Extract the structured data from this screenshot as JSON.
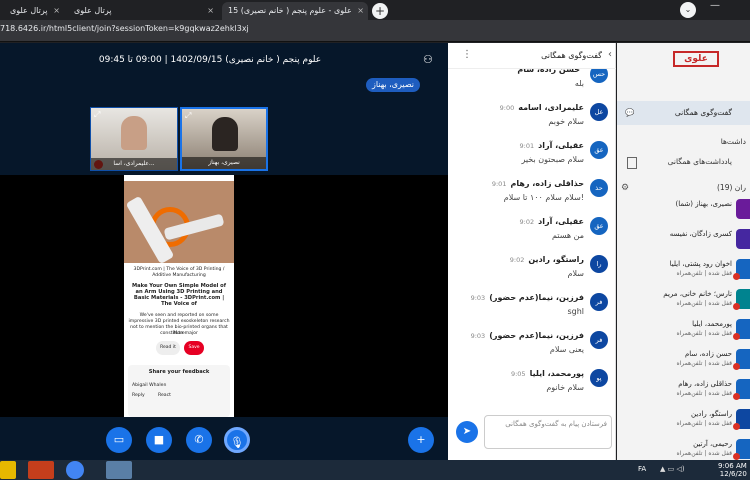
{
  "browser": {
    "tabs": [
      {
        "label": "پرتال علوی",
        "close": "×"
      },
      {
        "label": "پرتال علوی",
        "close": "×"
      },
      {
        "label": "علوی - علوم پنجم ( خانم نصیری) 15",
        "close": "×"
      }
    ],
    "new_tab": "+",
    "menu": "⌄",
    "url": "718.6426.ir/html5client/join?sessionToken=k9gqkwaz2ehkl3xj"
  },
  "session": {
    "title": "علوم پنجم ( خانم نصیری) 1402/09/15 | 09:00 تا 09:45",
    "presenter": "نصیری، بهناز",
    "cams": [
      {
        "name": "علیمرادی، اسا..."
      },
      {
        "name": "نصیری، بهناز"
      }
    ]
  },
  "shared_screen": {
    "source": "3DPrint.com | The Voice of 3D Printing / Additive Manufacturing",
    "headline": "Make Your Own Simple Model of an Arm Using 3D Printing and Basic Materials - 3DPrint.com | The Voice of",
    "body": "We've seen and reported on some impressive 3D printed exoskeleton research not to mention the bio-printed organs that constitute major",
    "more": "More",
    "read_btn": "Read it",
    "save_btn": "Save",
    "feedback_title": "Share your feedback",
    "feedback_user": "Abigail Whalen",
    "feedback_reply": "Reply",
    "feedback_react": "React"
  },
  "controls": {
    "screen": "▭",
    "video": "■",
    "phone": "✆",
    "mic": "🎙",
    "plus": "+"
  },
  "chat": {
    "title": "گفت‌وگوی همگانی",
    "back": "‹",
    "dots": "⋮",
    "messages": [
      {
        "initials": "حس",
        "name": "حسن زاده، سام",
        "time": "",
        "text": "بله",
        "color": "#1565c0"
      },
      {
        "initials": "عل",
        "name": "علیمرادی، اسامه",
        "time": "9:00",
        "text": "سلام خوبم",
        "color": "#0d47a1"
      },
      {
        "initials": "عق",
        "name": "عقیلی، آراد",
        "time": "9:01",
        "text": "سلام صبحتون بخیر",
        "color": "#1565c0"
      },
      {
        "initials": "حذ",
        "name": "حذاقلی زاده، رهام",
        "time": "9:01",
        "text": "سلام سلام ۱۰۰ تا سلام!",
        "color": "#1565c0"
      },
      {
        "initials": "عق",
        "name": "عقیلی، آراد",
        "time": "9:02",
        "text": "من هستم",
        "color": "#1565c0"
      },
      {
        "initials": "را",
        "name": "راستگو، رادین",
        "time": "9:02",
        "text": "سلام",
        "color": "#0d47a1"
      },
      {
        "initials": "فر",
        "name": "فرزین، نیما(عدم حضور)",
        "time": "9:03",
        "text": "sghl",
        "color": "#0d47a1"
      },
      {
        "initials": "فر",
        "name": "فرزین، نیما(عدم حضور)",
        "time": "9:03",
        "text": "یعنی سلام",
        "color": "#0d47a1"
      },
      {
        "initials": "پو",
        "name": "پورمحمد، ایلیا",
        "time": "9:05",
        "text": "سلام خانوم",
        "color": "#0d47a1"
      }
    ],
    "input_placeholder": "فرستادن پیام به گفت‌وگوی همگانی",
    "send": "➤"
  },
  "users_panel": {
    "logo": "علوی",
    "public_chat": "گفت‌وگوی همگانی",
    "notes_header": "داشت‌ها",
    "shared_notes": "یادداشت‌های همگانی",
    "users_header": "ران (19)",
    "users": [
      {
        "name": "نصیری، بهناز (شما)",
        "status": "",
        "color": "#6a1b9a"
      },
      {
        "name": "کسری زادگان، نفیسه",
        "status": "",
        "color": "#4527a0"
      },
      {
        "name": "اخوان رود پشتی، ایلیا",
        "status": "قفل شده | تلفن‌همراه",
        "color": "#1565c0"
      },
      {
        "name": "تارس؛ خانم خانی، مریم",
        "status": "قفل شده | تلفن‌همراه",
        "color": "#00838f"
      },
      {
        "name": "پورمحمد، ایلیا",
        "status": "قفل شده | تلفن‌همراه",
        "color": "#1565c0"
      },
      {
        "name": "حسن زاده، سام",
        "status": "قفل شده | تلفن‌همراه",
        "color": "#1565c0"
      },
      {
        "name": "حذاقلی زاده، رهام",
        "status": "قفل شده | تلفن‌همراه",
        "color": "#1565c0"
      },
      {
        "name": "راستگو، رادین",
        "status": "قفل شده | تلفن‌همراه",
        "color": "#0d47a1"
      },
      {
        "name": "رحیمی، آرتین",
        "status": "قفل شده | تلفن‌همراه",
        "color": "#1565c0"
      }
    ]
  },
  "taskbar": {
    "lang": "FA",
    "time": "9:06 AM",
    "date": "12/6/20"
  }
}
